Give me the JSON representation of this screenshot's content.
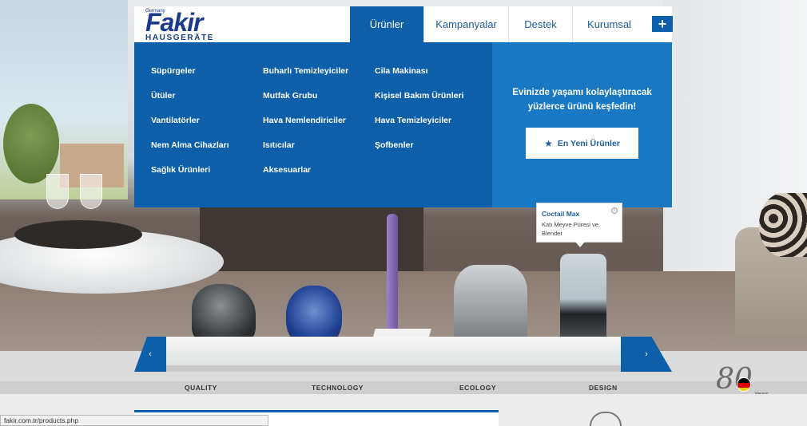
{
  "brand": {
    "small": "Germany",
    "name": "Fakir",
    "sub": "HAUSGERÄTE"
  },
  "nav": {
    "items": [
      {
        "label": "Ürünler",
        "active": true
      },
      {
        "label": "Kampanyalar"
      },
      {
        "label": "Destek"
      },
      {
        "label": "Kurumsal"
      }
    ],
    "plus": "+"
  },
  "menu": {
    "col1": [
      "Süpürgeler",
      "Ütüler",
      "Vantilatörler",
      "Nem Alma Cihazları",
      "Sağlık Ürünleri"
    ],
    "col2": [
      "Buharlı Temizleyiciler",
      "Mutfak Grubu",
      "Hava Nemlendiriciler",
      "Isıtıcılar",
      "Aksesuarlar"
    ],
    "col3": [
      "Cila Makinası",
      "Kişisel Bakım Ürünleri",
      "Hava Temizleyiciler",
      "Şofbenler"
    ]
  },
  "promo": {
    "text": "Evinizde yaşamı kolaylaştıracak yüzlerce ürünü keşfedin!",
    "button": "En Yeni Ürünler",
    "button_icon": "star-icon"
  },
  "tooltip": {
    "title": "Coctail Max",
    "desc": "Katı Meyve Püresi ve Blender",
    "info": "i"
  },
  "shelf": {
    "prev": "‹",
    "next": "›"
  },
  "pillars": [
    "QUALITY",
    "TECHNOLOGY",
    "ECOLOGY",
    "DESIGN"
  ],
  "badge": {
    "number": "80",
    "label": "Years"
  },
  "status_url": "fakir.com.tr/products.php",
  "colors": {
    "primary": "#0d5faa",
    "promo": "#1878c4",
    "flag": [
      "#000000",
      "#dd0000",
      "#ffce00"
    ]
  }
}
